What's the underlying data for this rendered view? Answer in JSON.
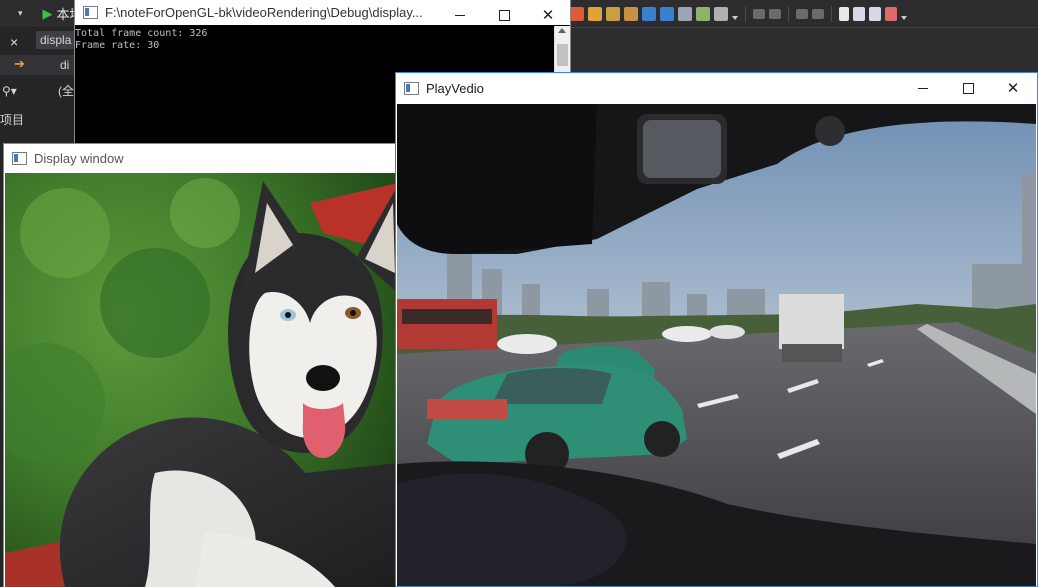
{
  "ide": {
    "toolbar": {
      "run_label": "本地"
    },
    "side": {
      "close_glyph": "×",
      "tab_label": "displa",
      "arrow_label": "di",
      "scope_label": "(全",
      "search_label": "⚲▾",
      "project_label": "项目"
    }
  },
  "console": {
    "title": "F:\\noteForOpenGL-bk\\videoRendering\\Debug\\display...",
    "lines": [
      "Total frame count: 326",
      "Frame rate: 30"
    ]
  },
  "display_window": {
    "title": "Display window"
  },
  "play_window": {
    "title": "PlayVedio"
  },
  "colors": {
    "ide_bg": "#2d2d30",
    "play_border": "#3b86d8",
    "console_bg": "#000000"
  }
}
